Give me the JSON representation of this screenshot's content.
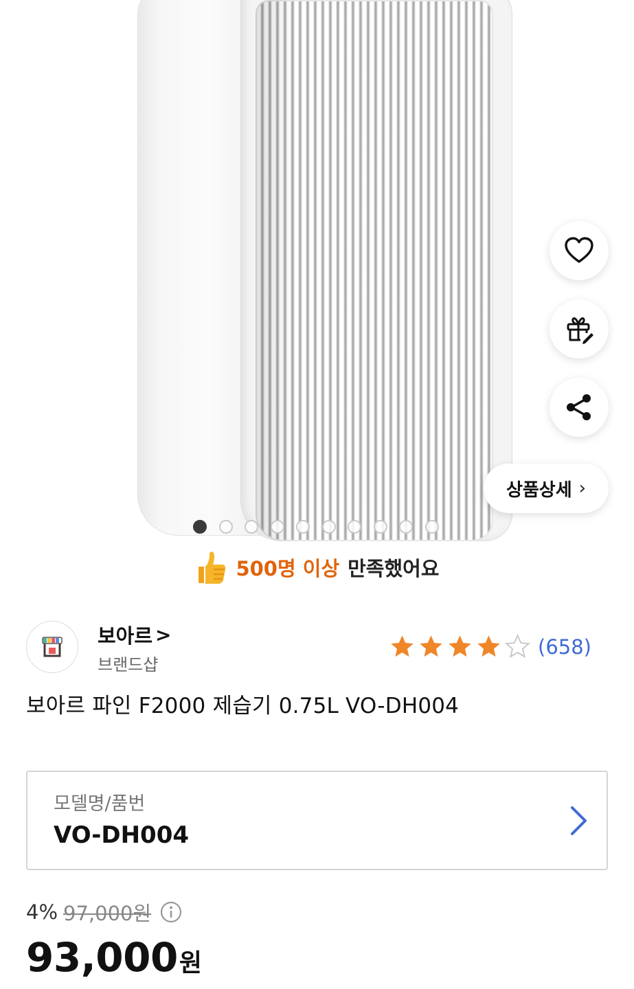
{
  "carousel": {
    "total": 10,
    "active": 0
  },
  "actions": {
    "detail_label": "상품상세",
    "detail_chevron": "›"
  },
  "banner": {
    "highlight": "500명 이상",
    "rest": "만족했어요",
    "highlight_color": "#e0640d"
  },
  "seller": {
    "name": "보아르",
    "chevron": ">",
    "type": "브랜드샵"
  },
  "rating": {
    "stars": 4,
    "max_stars": 5,
    "count": "(658)",
    "star_color": "#f0862a"
  },
  "product": {
    "title": "보아르 파인 F2000 제습기 0.75L VO-DH004"
  },
  "model": {
    "label": "모델명/품번",
    "value": "VO-DH004",
    "chevron_color": "#3f6bd6"
  },
  "price": {
    "discount_rate": "4%",
    "original": "97,000원",
    "final_number": "93,000",
    "final_unit": "원"
  }
}
